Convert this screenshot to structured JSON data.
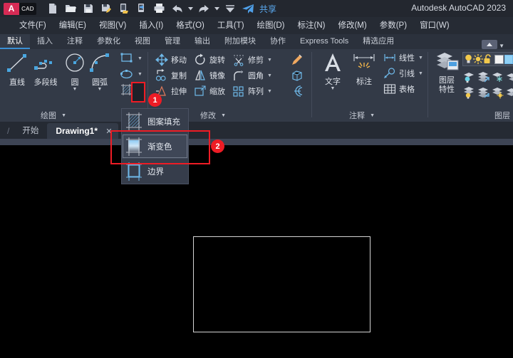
{
  "window": {
    "app_title": "Autodesk AutoCAD 2023",
    "logo_a": "A",
    "logo_cad": "CAD",
    "share_label": "共享"
  },
  "quick_access": [
    {
      "name": "new-file-icon",
      "glyph": "new"
    },
    {
      "name": "open-folder-icon",
      "glyph": "open"
    },
    {
      "name": "save-icon",
      "glyph": "save"
    },
    {
      "name": "save-as-icon",
      "glyph": "saveas"
    },
    {
      "name": "save-to-web-icon",
      "glyph": "webmobile"
    },
    {
      "name": "open-from-web-icon",
      "glyph": "openweb"
    },
    {
      "name": "plot-print-icon",
      "glyph": "print"
    },
    {
      "name": "undo-icon",
      "glyph": "undo"
    },
    {
      "name": "undo-dropdown-icon",
      "glyph": "caret"
    },
    {
      "name": "redo-icon",
      "glyph": "redo"
    },
    {
      "name": "redo-dropdown-icon",
      "glyph": "caret"
    },
    {
      "name": "customize-qat-icon",
      "glyph": "caret-wide"
    },
    {
      "name": "share-icon",
      "glyph": "send"
    }
  ],
  "menubar": [
    "文件(F)",
    "编辑(E)",
    "视图(V)",
    "插入(I)",
    "格式(O)",
    "工具(T)",
    "绘图(D)",
    "标注(N)",
    "修改(M)",
    "参数(P)",
    "窗口(W)"
  ],
  "ribbon_tabs": {
    "items": [
      {
        "label": "默认",
        "active": true
      },
      {
        "label": "插入",
        "active": false
      },
      {
        "label": "注释",
        "active": false
      },
      {
        "label": "参数化",
        "active": false
      },
      {
        "label": "视图",
        "active": false
      },
      {
        "label": "管理",
        "active": false
      },
      {
        "label": "输出",
        "active": false
      },
      {
        "label": "附加模块",
        "active": false
      },
      {
        "label": "协作",
        "active": false
      },
      {
        "label": "Express Tools",
        "active": false
      },
      {
        "label": "精选应用",
        "active": false
      }
    ]
  },
  "ribbon_panels": {
    "draw": {
      "title": "绘图",
      "big_buttons": [
        {
          "label": "直线",
          "icon": "line-icon",
          "has_caret": false
        },
        {
          "label": "多段线",
          "icon": "polyline-icon",
          "has_caret": false
        },
        {
          "label": "圆",
          "icon": "circle-icon",
          "has_caret": true
        },
        {
          "label": "圆弧",
          "icon": "arc-icon",
          "has_caret": true
        }
      ],
      "small_buttons": [
        {
          "label": "",
          "icon": "rectangle-icon",
          "has_caret": true
        },
        {
          "label": "",
          "icon": "ellipse-icon",
          "has_caret": true
        },
        {
          "label": "",
          "icon": "hatch-icon",
          "has_caret": true
        }
      ]
    },
    "modify": {
      "title": "修改",
      "buttons": [
        {
          "label": "移动",
          "icon": "move-icon",
          "has_caret": false
        },
        {
          "label": "旋转",
          "icon": "rotate-icon",
          "has_caret": false
        },
        {
          "label": "修剪",
          "icon": "trim-icon",
          "has_caret": true
        },
        {
          "label": "复制",
          "icon": "copy-icon",
          "has_caret": false
        },
        {
          "label": "镜像",
          "icon": "mirror-icon",
          "has_caret": false
        },
        {
          "label": "圆角",
          "icon": "fillet-icon",
          "has_caret": true
        },
        {
          "label": "拉伸",
          "icon": "stretch-icon",
          "has_caret": false
        },
        {
          "label": "缩放",
          "icon": "scale-icon",
          "has_caret": false
        },
        {
          "label": "阵列",
          "icon": "array-icon",
          "has_caret": true
        }
      ],
      "extra_icons": [
        {
          "name": "match-properties-icon"
        },
        {
          "name": "explode-icon"
        },
        {
          "name": "offset-icon"
        }
      ]
    },
    "annotation": {
      "title": "注释",
      "big_buttons": [
        {
          "label": "文字",
          "icon": "text-icon",
          "has_caret": true
        },
        {
          "label": "标注",
          "icon": "dimension-icon",
          "has_caret": false
        }
      ],
      "small_buttons": [
        {
          "label": "线性",
          "icon": "linear-dim-icon",
          "has_caret": true
        },
        {
          "label": "引线",
          "icon": "leader-icon",
          "has_caret": true
        },
        {
          "label": "表格",
          "icon": "table-icon",
          "has_caret": false
        }
      ]
    },
    "layers": {
      "title": "图层",
      "big_button": {
        "label_line1": "图层",
        "label_line2": "特性",
        "icon": "layer-properties-icon"
      },
      "toolbar_icons": [
        {
          "name": "layer-on-off-icon"
        },
        {
          "name": "layer-thaw-icon"
        },
        {
          "name": "layer-unlock-icon"
        },
        {
          "name": "layer-color-icon"
        },
        {
          "name": "layer-plot-icon"
        }
      ],
      "grid_icons": [
        {
          "name": "layer-isolate-icon"
        },
        {
          "name": "layer-match-icon"
        },
        {
          "name": "layer-freeze-icon"
        },
        {
          "name": "layer-off-icon"
        },
        {
          "name": "layer-turn-all-on-icon"
        },
        {
          "name": "layer-change-to-current-icon"
        },
        {
          "name": "layer-thaw-all-icon"
        },
        {
          "name": "layer-previous-icon"
        }
      ]
    }
  },
  "file_tabs": {
    "start_label": "开始",
    "drawing_label": "Drawing1*",
    "close_glyph": "✕"
  },
  "dropdown_menu": {
    "items": [
      {
        "label": "图案填充",
        "icon": "hatch-pattern-icon",
        "selected": false
      },
      {
        "label": "渐变色",
        "icon": "gradient-icon",
        "selected": true
      },
      {
        "label": "边界",
        "icon": "boundary-icon",
        "selected": false
      }
    ]
  },
  "annotations": [
    {
      "badge": "1",
      "target": "hatch-dropdown-arrow"
    },
    {
      "badge": "2",
      "target": "gradient-menu-item"
    }
  ],
  "canvas": {
    "shape": "rectangle",
    "stroke_color": "#d4d4d4",
    "background": "#000000"
  },
  "colors": {
    "titlebar": "#23272f",
    "menubar": "#262b34",
    "ribbon": "#333a47",
    "ribbon_tabbar": "#2b313c",
    "file_tabbar": "#252a33",
    "file_tab_strip": "#3d4454",
    "accent_blue": "#5aa9f0",
    "annotation_red": "#ee1c25",
    "logo_red": "#d72b55",
    "icon_blue": "#6fb8e8",
    "icon_gray": "#c9ced8"
  }
}
